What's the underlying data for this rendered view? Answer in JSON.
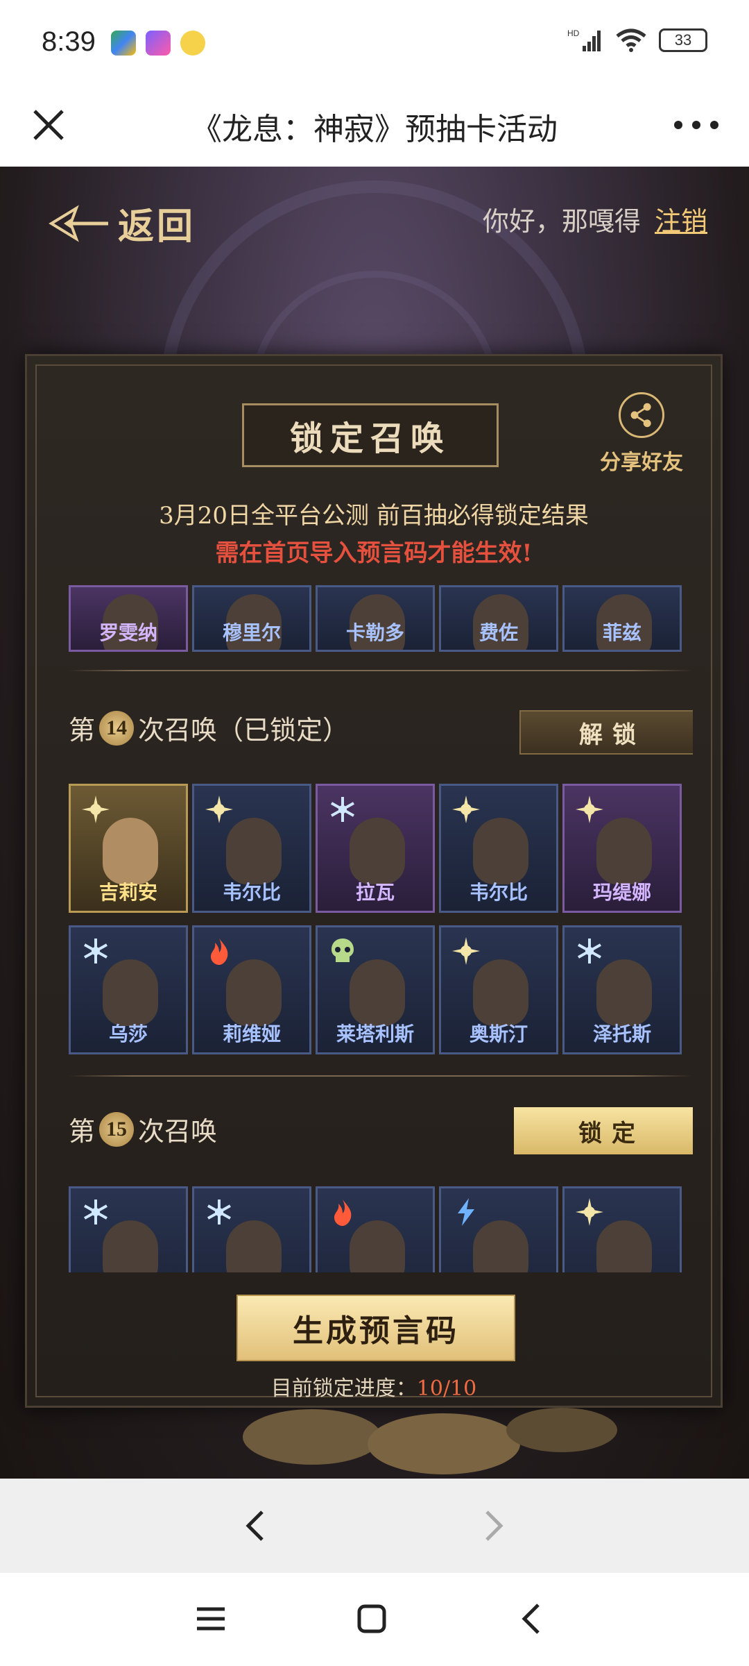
{
  "status_bar": {
    "time": "8:39",
    "battery": "33",
    "network": "HD"
  },
  "title_bar": {
    "title": "《龙息：神寂》预抽卡活动"
  },
  "header": {
    "back_label": "返回",
    "greeting": "你好，那嘎得",
    "logout": "注销"
  },
  "panel": {
    "heading": "锁定召唤",
    "share_label": "分享好友",
    "notice": "3月20日全平台公测 前百抽必得锁定结果",
    "warning": "需在首页导入预言码才能生效!"
  },
  "prev_row": {
    "cards": [
      {
        "name": "罗雯纳",
        "rarity": "purple"
      },
      {
        "name": "穆里尔",
        "rarity": "blue"
      },
      {
        "name": "卡勒多",
        "rarity": "blue"
      },
      {
        "name": "费佐",
        "rarity": "blue"
      },
      {
        "name": "菲兹",
        "rarity": "blue"
      }
    ]
  },
  "summon14": {
    "prefix": "第",
    "number": "14",
    "suffix": "次召唤（已锁定）",
    "button": "解锁",
    "row1": [
      {
        "name": "吉莉安",
        "rarity": "gold",
        "element": "sun"
      },
      {
        "name": "韦尔比",
        "rarity": "blue",
        "element": "sun"
      },
      {
        "name": "拉瓦",
        "rarity": "purple",
        "element": "frost"
      },
      {
        "name": "韦尔比",
        "rarity": "blue",
        "element": "sun"
      },
      {
        "name": "玛缇娜",
        "rarity": "purple",
        "element": "sun"
      }
    ],
    "row2": [
      {
        "name": "乌莎",
        "rarity": "blue",
        "element": "frost"
      },
      {
        "name": "莉维娅",
        "rarity": "blue",
        "element": "fire"
      },
      {
        "name": "莱塔利斯",
        "rarity": "blue",
        "element": "skull"
      },
      {
        "name": "奥斯汀",
        "rarity": "blue",
        "element": "sun"
      },
      {
        "name": "泽托斯",
        "rarity": "blue",
        "element": "frost"
      }
    ]
  },
  "summon15": {
    "prefix": "第",
    "number": "15",
    "suffix": "次召唤",
    "button": "锁定",
    "elements": [
      "frost",
      "frost",
      "fire",
      "lightning",
      "sun"
    ]
  },
  "footer": {
    "generate_button": "生成预言码",
    "progress_label": "目前锁定进度：",
    "progress_value": "10/10"
  },
  "colors": {
    "gold": "#e1c07a",
    "warning_red": "#e5513e",
    "progress_red": "#ef6b44"
  }
}
